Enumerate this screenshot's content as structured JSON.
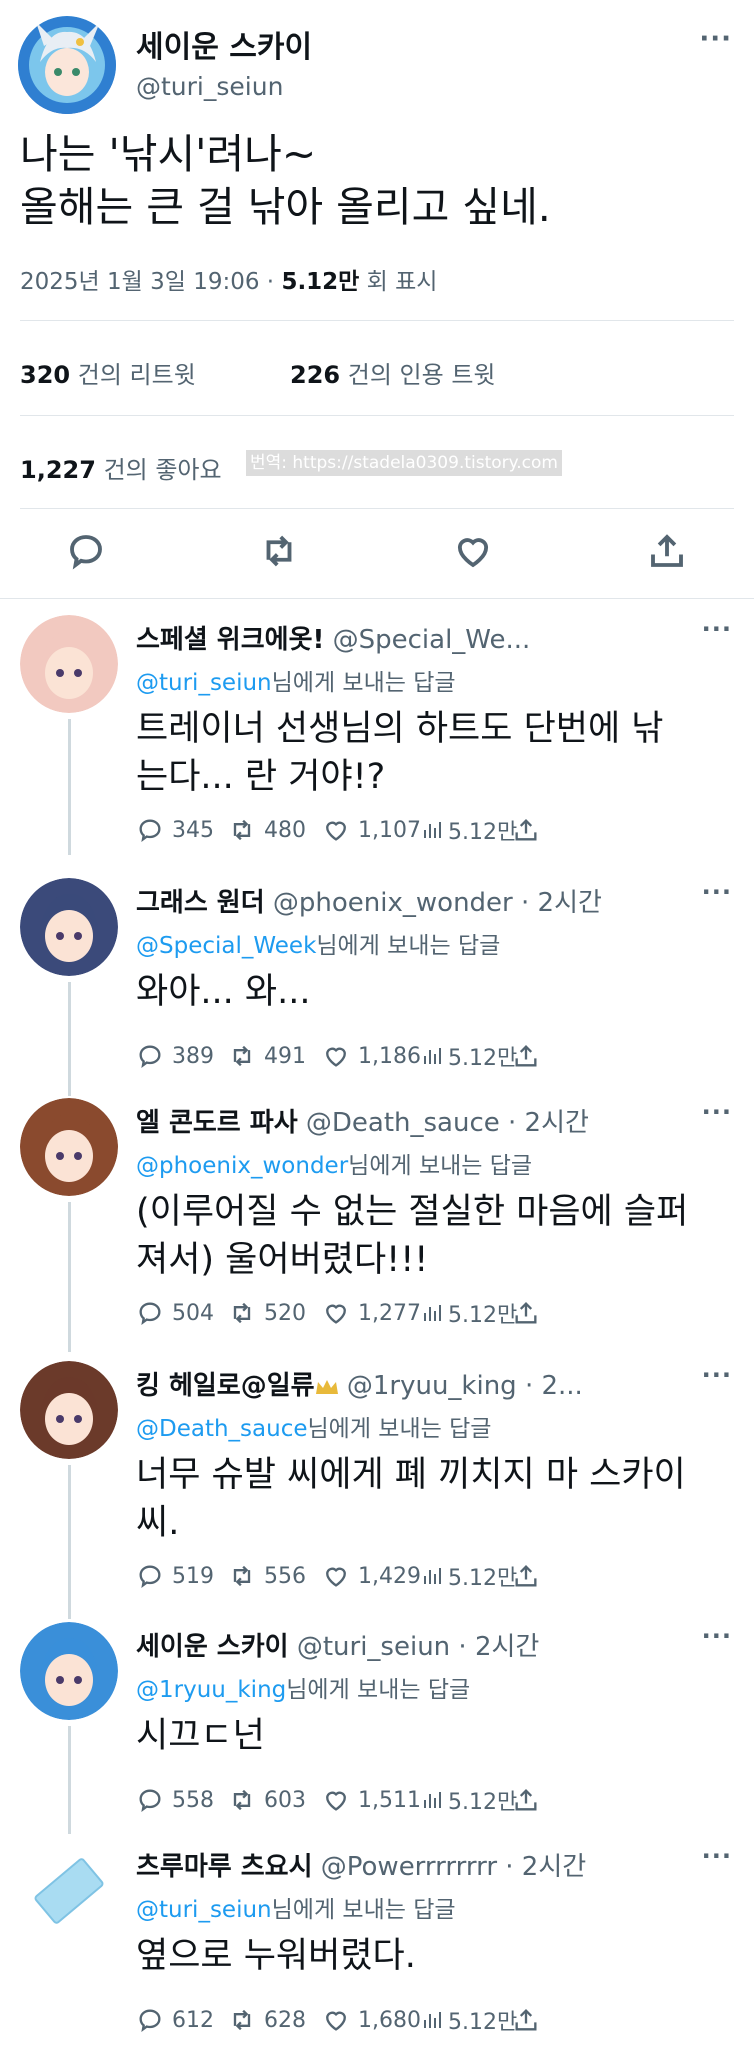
{
  "main_tweet": {
    "display_name": "세이운 스카이",
    "handle": "@turi_seiun",
    "text": "나는 '낚시'려나~\n올해는 큰 걸 낚아 올리고 싶네.",
    "timestamp": "2025년 1월 3일 19:06 ·",
    "views": "5.12만",
    "views_label": "회 표시",
    "retweets": "320",
    "retweets_label": "건의 리트윗",
    "quotes": "226",
    "quotes_label": "건의 인용 트윗",
    "likes": "1,227",
    "likes_label": "건의 좋아요",
    "watermark": "번역: https://stadela0309.tistory.com",
    "more": "···"
  },
  "replies": [
    {
      "display_name": "스페셜 위크에옷!",
      "handle": "@Special_We...",
      "time": "",
      "reply_to": "@turi_seiun",
      "reply_suffix": "님에게 보내는 답글",
      "text": "트레이너 선생님의 하트도 단번에 낚\n는다... 란 거야!?",
      "replies": "345",
      "retweets": "480",
      "likes": "1,107",
      "views": "5.12만",
      "avatar_color": "#f2c9c0"
    },
    {
      "display_name": "그래스 원더",
      "handle": "@phoenix_wonder",
      "time": " · 2시간",
      "reply_to": "@Special_Week",
      "reply_suffix": "님에게 보내는 답글",
      "text": "와아... 와...",
      "replies": "389",
      "retweets": "491",
      "likes": "1,186",
      "views": "5.12만",
      "avatar_color": "#3b4a7a"
    },
    {
      "display_name": "엘 콘도르 파사",
      "handle": "@Death_sauce",
      "time": " · 2시간",
      "reply_to": "@phoenix_wonder",
      "reply_suffix": "님에게 보내는 답글",
      "text": "(이루어질 수 없는 절실한 마음에 슬퍼\n져서) 울어버렸다!!!",
      "replies": "504",
      "retweets": "520",
      "likes": "1,277",
      "views": "5.12만",
      "avatar_color": "#8a4a2e"
    },
    {
      "display_name": "킹 헤일로@일류",
      "handle": "@1ryuu_king · 2...",
      "time": "",
      "reply_to": "@Death_sauce",
      "reply_suffix": "님에게 보내는 답글",
      "text": "너무 슈발 씨에게 폐 끼치지 마 스카이\n씨.",
      "replies": "519",
      "retweets": "556",
      "likes": "1,429",
      "views": "5.12만",
      "avatar_color": "#6b3a2a"
    },
    {
      "display_name": "세이운 스카이",
      "handle": "@turi_seiun",
      "time": " · 2시간",
      "reply_to": "@1ryuu_king",
      "reply_suffix": "님에게 보내는 답글",
      "text": "시끄ㄷ넌",
      "replies": "558",
      "retweets": "603",
      "likes": "1,511",
      "views": "5.12만",
      "avatar_color": "#3a8fd9"
    },
    {
      "display_name": "츠루마루 츠요시",
      "handle": "@Powerrrrrrrr",
      "time": " · 2시간",
      "reply_to": "@turi_seiun",
      "reply_suffix": "님에게 보내는 답글",
      "text": "옆으로 누워버렸다.",
      "replies": "612",
      "retweets": "628",
      "likes": "1,680",
      "views": "5.12만",
      "avatar_color": "#a9dcf2"
    }
  ],
  "more": "···"
}
